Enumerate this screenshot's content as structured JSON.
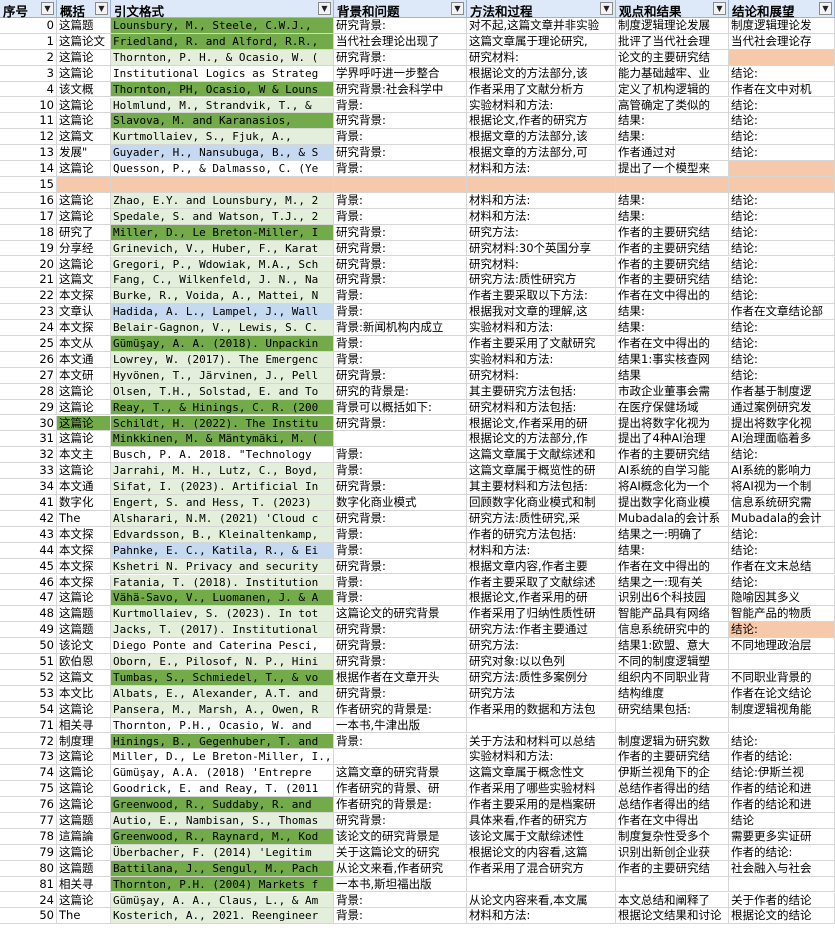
{
  "headers": [
    "序号",
    "概括",
    "引文格式",
    "背景和问题",
    "方法和过程",
    "观点和结果",
    "结论和展望"
  ],
  "filter_icon": "filter-dropdown-icon",
  "colors": {
    "green": "#73ab4a",
    "light_green": "#e3efda",
    "blue": "#c5d9f0",
    "peach": "#f7c9ab",
    "header": "#dde9f8"
  },
  "rows": [
    {
      "cells": [
        "0",
        "这篇题",
        "Lounsbury, M., Steele, C.W.J.,",
        "研究背景:",
        "对不起,这篇文章并非实验",
        "制度逻辑理论发展",
        "制度逻辑理论发"
      ],
      "fill": [
        "",
        "",
        "green",
        "",
        "",
        "",
        ""
      ]
    },
    {
      "cells": [
        "1",
        "这篇论文",
        "Friedland, R. and Alford, R.R.,",
        "当代社会理论出现了",
        "这篇文章属于理论研究,",
        "批评了当代社会理",
        "当代社会理论存"
      ],
      "fill": [
        "",
        "",
        "green",
        "",
        "",
        "",
        ""
      ]
    },
    {
      "cells": [
        "2",
        "这篇论",
        "Thornton, P. H., & Ocasio, W. (",
        "研究背景:",
        "研究材料:",
        "论文的主要研究结",
        ""
      ],
      "fill": [
        "",
        "",
        "lgreen",
        "",
        "",
        "",
        "peach"
      ]
    },
    {
      "cells": [
        "3",
        "这篇论",
        "Institutional Logics as Strateg",
        "学界呼吁进一步整合",
        "根据论文的方法部分,该",
        "能力基础越牢、业",
        "结论:"
      ],
      "fill": [
        "",
        "",
        "",
        "",
        "",
        "",
        ""
      ]
    },
    {
      "cells": [
        "4",
        "该文概",
        "Thornton, PH, Ocasio, W & Louns",
        "研究背景:社会科学中",
        "作者采用了文献分析方",
        "定义了机构逻辑的",
        "作者在文中对机"
      ],
      "fill": [
        "",
        "",
        "green",
        "",
        "",
        "",
        ""
      ]
    },
    {
      "cells": [
        "10",
        "这篇论",
        "Holmlund, M., Strandvik, T., &",
        "背景:",
        "实验材料和方法:",
        "高管确定了类似的",
        "结论:"
      ],
      "fill": [
        "",
        "",
        "lgreen",
        "",
        "",
        "",
        ""
      ]
    },
    {
      "cells": [
        "11",
        "这篇论",
        "Slavova, M. and Karanasios,",
        "研究背景:",
        "根据论文,作者的研究方",
        "结果:",
        "结论:"
      ],
      "fill": [
        "",
        "",
        "green",
        "",
        "",
        "",
        ""
      ]
    },
    {
      "cells": [
        "12",
        "这篇文",
        "Kurtmollaiev, S., Fjuk, A.,",
        "背景:",
        "根据文章的方法部分,该",
        "结果:",
        "结论:"
      ],
      "fill": [
        "",
        "",
        "lgreen",
        "",
        "",
        "",
        ""
      ]
    },
    {
      "cells": [
        "13",
        "发展\"",
        "Guyader, H., Nansubuga, B., & S",
        "研究背景:",
        "根据文章的方法部分,可",
        "作者通过对",
        "结论:"
      ],
      "fill": [
        "",
        "",
        "blue",
        "",
        "",
        "",
        ""
      ]
    },
    {
      "cells": [
        "14",
        "这篇论",
        "Quesson, P., & Dalmasso, C. (Ye",
        "背景:",
        "材料和方法:",
        "提出了一个模型来",
        ""
      ],
      "fill": [
        "",
        "",
        "",
        "",
        "",
        "",
        "peach"
      ]
    },
    {
      "cells": [
        "15",
        "",
        "",
        "",
        "",
        "",
        ""
      ],
      "fill": [
        "",
        "peach",
        "peach",
        "peach",
        "peach",
        "peach",
        "peach"
      ]
    },
    {
      "cells": [
        "16",
        "这篇论",
        "Zhao, E.Y. and Lounsbury, M., 2",
        "背景:",
        "材料和方法:",
        "结果:",
        "结论:"
      ],
      "fill": [
        "",
        "",
        "lgreen",
        "",
        "",
        "",
        ""
      ]
    },
    {
      "cells": [
        "17",
        "这篇论",
        "Spedale, S. and Watson, T.J., 2",
        "背景:",
        "材料和方法:",
        "结果:",
        "结论:"
      ],
      "fill": [
        "",
        "",
        "lgreen",
        "",
        "",
        "",
        ""
      ]
    },
    {
      "cells": [
        "18",
        "研究了",
        "Miller, D., Le Breton-Miller, I",
        "研究背景:",
        "研究方法:",
        "作者的主要研究结",
        "结论:"
      ],
      "fill": [
        "",
        "",
        "green",
        "",
        "",
        "",
        ""
      ]
    },
    {
      "cells": [
        "19",
        "分享经",
        "Grinevich, V., Huber, F., Karat",
        "研究背景:",
        "研究材料:30个英国分享",
        "作者的主要研究结",
        "结论:"
      ],
      "fill": [
        "",
        "",
        "lgreen",
        "",
        "",
        "",
        ""
      ]
    },
    {
      "cells": [
        "20",
        "这篇论",
        "Gregori, P., Wdowiak, M.A., Sch",
        "研究背景:",
        "研究材料:",
        "作者的主要研究结",
        "结论:"
      ],
      "fill": [
        "",
        "",
        "lgreen",
        "",
        "",
        "",
        ""
      ]
    },
    {
      "cells": [
        "21",
        "这篇文",
        "Fang, C., Wilkenfeld, J. N., Na",
        "研究背景:",
        "研究方法:质性研究方",
        "作者的主要研究结",
        "结论:"
      ],
      "fill": [
        "",
        "",
        "lgreen",
        "",
        "",
        "",
        ""
      ]
    },
    {
      "cells": [
        "22",
        "本文探",
        "Burke, R., Voida, A., Mattei, N",
        "背景:",
        "作者主要采取以下方法:",
        "作者在文中得出的",
        "结论:"
      ],
      "fill": [
        "",
        "",
        "lgreen",
        "",
        "",
        "",
        ""
      ]
    },
    {
      "cells": [
        "23",
        "文章认",
        "Hadida, A. L., Lampel, J., Wall",
        "背景:",
        "根据我对文章的理解,这",
        "结果:",
        "作者在文章结论部"
      ],
      "fill": [
        "",
        "",
        "blue",
        "",
        "",
        "",
        ""
      ]
    },
    {
      "cells": [
        "24",
        "本文探",
        "Belair-Gagnon, V., Lewis, S. C.",
        "背景:新闻机构内成立",
        "实验材料和方法:",
        "结果:",
        "结论:"
      ],
      "fill": [
        "",
        "",
        "lgreen",
        "",
        "",
        "",
        ""
      ]
    },
    {
      "cells": [
        "25",
        "本文从",
        "Gümüşay, A. A. (2018). Unpackin",
        "背景:",
        "作者主要采用了文献研究",
        "作者在文中得出的",
        "结论:"
      ],
      "fill": [
        "",
        "",
        "green",
        "",
        "",
        "",
        ""
      ]
    },
    {
      "cells": [
        "26",
        "本文通",
        "Lowrey, W. (2017). The Emergenc",
        "背景:",
        "实验材料和方法:",
        "结果1:事实核查网",
        "结论:"
      ],
      "fill": [
        "",
        "",
        "lgreen",
        "",
        "",
        "",
        ""
      ]
    },
    {
      "cells": [
        "27",
        "本文研",
        "Hyvönen, T., Järvinen, J., Pell",
        "研究背景:",
        "研究材料:",
        "结果",
        "结论:"
      ],
      "fill": [
        "",
        "",
        "lgreen",
        "",
        "",
        "",
        ""
      ]
    },
    {
      "cells": [
        "28",
        "这篇论",
        "Olsen, T.H., Solstad, E. and To",
        "研究的背景是:",
        "其主要研究方法包括:",
        "市政企业董事会需",
        "作者基于制度逻"
      ],
      "fill": [
        "",
        "",
        "lgreen",
        "",
        "",
        "",
        ""
      ]
    },
    {
      "cells": [
        "29",
        "这篇论",
        "Reay, T., & Hinings, C. R. (200",
        "背景可以概括如下:",
        "研究材料和方法包括:",
        "在医疗保健场域",
        "通过案例研究发"
      ],
      "fill": [
        "",
        "",
        "green",
        "",
        "",
        "",
        ""
      ]
    },
    {
      "cells": [
        "30",
        "这篇论",
        "Schildt, H. (2022). The Institu",
        "研究背景:",
        "根据论文,作者采用的研",
        "提出将数字化视为",
        "提出将数字化视"
      ],
      "fill": [
        "",
        "green",
        "green",
        "",
        "",
        "",
        ""
      ]
    },
    {
      "cells": [
        "31",
        "这篇论",
        "Minkkinen, M. & Mäntymäki, M. (",
        "",
        "根据论文的方法部分,作",
        "提出了4种AI治理",
        "AI治理面临着多"
      ],
      "fill": [
        "",
        "",
        "green",
        "",
        "",
        "",
        ""
      ]
    },
    {
      "cells": [
        "32",
        "本文主",
        "Busch, P. A. 2018. \"Technology",
        "背景:",
        "这篇文章属于文献综述和",
        "作者的主要研究结",
        "结论:"
      ],
      "fill": [
        "",
        "",
        "",
        "",
        "",
        "",
        ""
      ]
    },
    {
      "cells": [
        "33",
        "这篇论",
        "Jarrahi, M. H., Lutz, C., Boyd,",
        "背景:",
        "这篇文章属于概览性的研",
        "AI系统的自学习能",
        "AI系统的影响力"
      ],
      "fill": [
        "",
        "",
        "lgreen",
        "",
        "",
        "",
        ""
      ]
    },
    {
      "cells": [
        "34",
        "本文通",
        "Sifat, I. (2023). Artificial In",
        "研究背景:",
        "其主要材料和方法包括:",
        "将AI概念化为一个",
        "将AI视为一个制"
      ],
      "fill": [
        "",
        "",
        "lgreen",
        "",
        "",
        "",
        ""
      ]
    },
    {
      "cells": [
        "41",
        "数字化",
        "Engert, S. and Hess, T. (2023)",
        "数字化商业模式",
        "回顾数字化商业模式和制",
        "提出数字化商业模",
        "信息系统研究需"
      ],
      "fill": [
        "",
        "",
        "lgreen",
        "",
        "",
        "",
        ""
      ]
    },
    {
      "cells": [
        "42",
        "The",
        "Alsharari, N.M. (2021) 'Cloud c",
        "研究背景:",
        "研究方法:质性研究,采",
        "Mubadala的会计系",
        "Mubadala的会计"
      ],
      "fill": [
        "",
        "",
        "lgreen",
        "",
        "",
        "",
        ""
      ]
    },
    {
      "cells": [
        "43",
        "本文探",
        "Edvardsson, B., Kleinaltenkamp,",
        "背景:",
        "作者的研究方法包括:",
        "结果之一:明确了",
        "结论:"
      ],
      "fill": [
        "",
        "",
        "lgreen",
        "",
        "",
        "",
        ""
      ]
    },
    {
      "cells": [
        "44",
        "本文探",
        "Pahnke, E. C., Katila, R., & Ei",
        "背景:",
        "材料和方法:",
        "结果:",
        "结论:"
      ],
      "fill": [
        "",
        "",
        "blue",
        "",
        "",
        "",
        ""
      ]
    },
    {
      "cells": [
        "45",
        "本文探",
        "Kshetri N. Privacy and security",
        "研究背景:",
        "根据文章内容,作者主要",
        "作者在文中得出的",
        "作者在文末总结"
      ],
      "fill": [
        "",
        "",
        "lgreen",
        "",
        "",
        "",
        ""
      ]
    },
    {
      "cells": [
        "46",
        "本文探",
        "Fatania, T. (2018). Institution",
        "背景:",
        "作者主要采取了文献综述",
        "结果之一:现有关",
        "结论:"
      ],
      "fill": [
        "",
        "",
        "lgreen",
        "",
        "",
        "",
        ""
      ]
    },
    {
      "cells": [
        "47",
        "这篇论",
        "Vähä-Savo, V., Luomanen, J. & A",
        "背景:",
        "根据论文,作者采用的研",
        "识别出6个科技园",
        "隐喻因其多义"
      ],
      "fill": [
        "",
        "",
        "green",
        "",
        "",
        "",
        ""
      ]
    },
    {
      "cells": [
        "48",
        "这篇题",
        "Kurtmollaiev, S. (2023). In tot",
        "这篇论文的研究背景",
        "作者采用了归纳性质性研",
        "智能产品具有网络",
        "智能产品的物质"
      ],
      "fill": [
        "",
        "",
        "lgreen",
        "",
        "",
        "",
        ""
      ]
    },
    {
      "cells": [
        "49",
        "这篇题",
        "Jacks, T. (2017). Institutional",
        "研究背景:",
        "研究方法:作者主要通过",
        "信息系统研究中的",
        "结论:"
      ],
      "fill": [
        "",
        "",
        "lgreen",
        "",
        "",
        "",
        "peach"
      ]
    },
    {
      "cells": [
        "50",
        "该论文",
        "Diego Ponte and Caterina Pesci,",
        "研究背景:",
        "研究方法:",
        "结果1:欧盟、意大",
        "不同地理政治层"
      ],
      "fill": [
        "",
        "",
        "",
        "",
        "",
        "",
        ""
      ]
    },
    {
      "cells": [
        "51",
        "欧伯恩",
        "Oborn, E., Pilosof, N. P., Hini",
        "研究背景:",
        "研究对象:以以色列",
        "不同的制度逻辑塑",
        ""
      ],
      "fill": [
        "",
        "",
        "lgreen",
        "",
        "",
        "",
        ""
      ]
    },
    {
      "cells": [
        "52",
        "这篇文",
        "Tumbas, S., Schmiedel, T., & vo",
        "根据作者在文章开头",
        "研究方法:质性多案例分",
        "组织内不同职业背",
        "不同职业背景的"
      ],
      "fill": [
        "",
        "",
        "green",
        "",
        "",
        "",
        ""
      ]
    },
    {
      "cells": [
        "53",
        "本文比",
        "Albats, E., Alexander, A.T. and",
        "研究背景:",
        "研究方法",
        "结构维度",
        "作者在论文结论"
      ],
      "fill": [
        "",
        "",
        "lgreen",
        "",
        "",
        "",
        ""
      ]
    },
    {
      "cells": [
        "54",
        "这篇论",
        "Pansera, M., Marsh, A., Owen, R",
        "作者研究的背景是:",
        "作者采用的数据和方法包",
        "研究结果包括:",
        "制度逻辑视角能"
      ],
      "fill": [
        "",
        "",
        "lgreen",
        "",
        "",
        "",
        ""
      ]
    },
    {
      "cells": [
        "71",
        "相关寻",
        "Thornton, P.H., Ocasio, W. and",
        "一本书,牛津出版",
        "",
        "",
        ""
      ],
      "fill": [
        "",
        "",
        "",
        "",
        "",
        "",
        ""
      ]
    },
    {
      "cells": [
        "72",
        "制度理",
        "Hinings, B., Gegenhuber, T. and",
        "背景:",
        "关于方法和材料可以总结",
        "制度逻辑为研究数",
        "结论:"
      ],
      "fill": [
        "",
        "",
        "green",
        "",
        "",
        "",
        ""
      ]
    },
    {
      "cells": [
        "73",
        "这篇论",
        "Miller, D., Le Breton-Miller, I., Amore, M.D., Min",
        "",
        "实验材料和方法:",
        "作者的主要研究结",
        "作者的结论:"
      ],
      "fill": [
        "",
        "",
        "",
        "",
        "",
        "",
        ""
      ]
    },
    {
      "cells": [
        "74",
        "这篇论",
        "Gümüşay, A.A. (2018) 'Entrepre",
        "这篇文章的研究背景",
        "这篇文章属于概念性文",
        "伊斯兰视角下的企",
        "结论:伊斯兰视"
      ],
      "fill": [
        "",
        "",
        "",
        "",
        "",
        "",
        ""
      ]
    },
    {
      "cells": [
        "75",
        "这篇论",
        "Goodrick, E. and Reay, T. (2011",
        "作者研究的背景、研",
        "作者采用了哪些实验材料",
        "总结作者得出的结",
        "作者的结论和进"
      ],
      "fill": [
        "",
        "",
        "",
        "",
        "",
        "",
        ""
      ]
    },
    {
      "cells": [
        "76",
        "这篇论",
        "Greenwood, R., Suddaby, R. and",
        "作者研究的背景是:",
        "作者主要采用的是档案研",
        "总结作者得出的结",
        "作者的结论和进"
      ],
      "fill": [
        "",
        "",
        "green",
        "",
        "",
        "",
        ""
      ]
    },
    {
      "cells": [
        "77",
        "这篇题",
        "Autio, E., Nambisan, S., Thomas",
        "研究背景:",
        "具体来看,作者的研究方",
        "作者在文中得出",
        "结论"
      ],
      "fill": [
        "",
        "",
        "lgreen",
        "",
        "",
        "",
        ""
      ]
    },
    {
      "cells": [
        "78",
        "這篇論",
        "Greenwood, R., Raynard, M., Kod",
        "该论文的研究背景是",
        "该论文属于文献综述性",
        "制度复杂性受多个",
        "需要更多实证研"
      ],
      "fill": [
        "",
        "",
        "green",
        "",
        "",
        "",
        ""
      ]
    },
    {
      "cells": [
        "79",
        "这篇论",
        "Überbacher, F. (2014) 'Legitim",
        "关于这篇论文的研究",
        "根据论文的内容看,这篇",
        "识别出新创企业获",
        "作者的结论:"
      ],
      "fill": [
        "",
        "",
        "lgreen",
        "",
        "",
        "",
        ""
      ]
    },
    {
      "cells": [
        "80",
        "这篇题",
        "Battilana, J., Sengul, M., Pach",
        "从论文来看,作者研究",
        "作者采用了混合研究方",
        "作者的主要研究结",
        "社会融入与社会"
      ],
      "fill": [
        "",
        "",
        "green",
        "",
        "",
        "",
        ""
      ]
    },
    {
      "cells": [
        "81",
        "相关寻",
        "Thornton, P.H. (2004) Markets f",
        "一本书,斯坦福出版",
        "",
        "",
        ""
      ],
      "fill": [
        "",
        "",
        "green",
        "",
        "",
        "",
        ""
      ]
    },
    {
      "cells": [
        "24",
        "这篇论",
        "Gümüşay, A. A., Claus, L., & Am",
        "背景:",
        "从论文内容来看,本文属",
        "本文总结和阐释了",
        "关于作者的结论"
      ],
      "fill": [
        "",
        "",
        "lgreen",
        "",
        "",
        "",
        ""
      ]
    },
    {
      "cells": [
        "50",
        "The",
        "Kosterich, A., 2021. Reengineer",
        "背景:",
        "材料和方法:",
        "根据论文结果和讨论",
        "根据论文的结论"
      ],
      "fill": [
        "",
        "",
        "lgreen",
        "",
        "",
        "",
        ""
      ]
    }
  ]
}
